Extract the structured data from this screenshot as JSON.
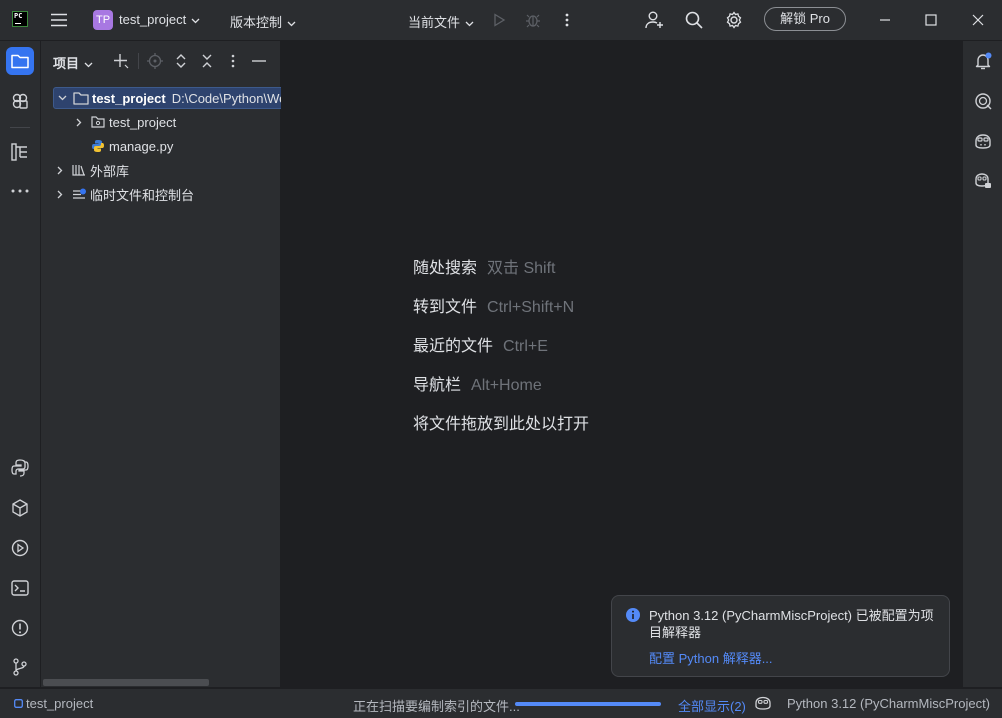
{
  "titlebar": {
    "app_logo": "PC",
    "project_badge": "TP",
    "project_name": "test_project",
    "vcs_menu": "版本控制",
    "run_config": "当前文件",
    "unlock_button": "解锁 Pro"
  },
  "project_panel": {
    "title": "项目",
    "tree": [
      {
        "label": "test_project",
        "path": "D:\\Code\\Python\\Web\\test_project",
        "expanded": true,
        "selected": true
      },
      {
        "label": "test_project",
        "expanded": false
      },
      {
        "label": "manage.py"
      },
      {
        "label": "外部库",
        "expanded": false
      },
      {
        "label": "临时文件和控制台",
        "expanded": false
      }
    ]
  },
  "editor_hints": [
    {
      "label": "随处搜索",
      "shortcut": "双击 Shift"
    },
    {
      "label": "转到文件",
      "shortcut": "Ctrl+Shift+N"
    },
    {
      "label": "最近的文件",
      "shortcut": "Ctrl+E"
    },
    {
      "label": "导航栏",
      "shortcut": "Alt+Home"
    },
    {
      "label": "将文件拖放到此处以打开",
      "shortcut": ""
    }
  ],
  "notification": {
    "message": "Python 3.12 (PyCharmMiscProject) 已被配置为项目解释器",
    "link": "配置 Python 解释器..."
  },
  "statusbar": {
    "project": "test_project",
    "indexing_text": "正在扫描要编制索引的文件...",
    "progress": 1.0,
    "show_all": "全部显示(2)",
    "interpreter": "Python 3.12 (PyCharmMiscProject)"
  },
  "colors": {
    "accent": "#3574f0",
    "link": "#548af7",
    "badge": "#a878e2",
    "background": "#1e1f22",
    "panel": "#2b2d30"
  }
}
